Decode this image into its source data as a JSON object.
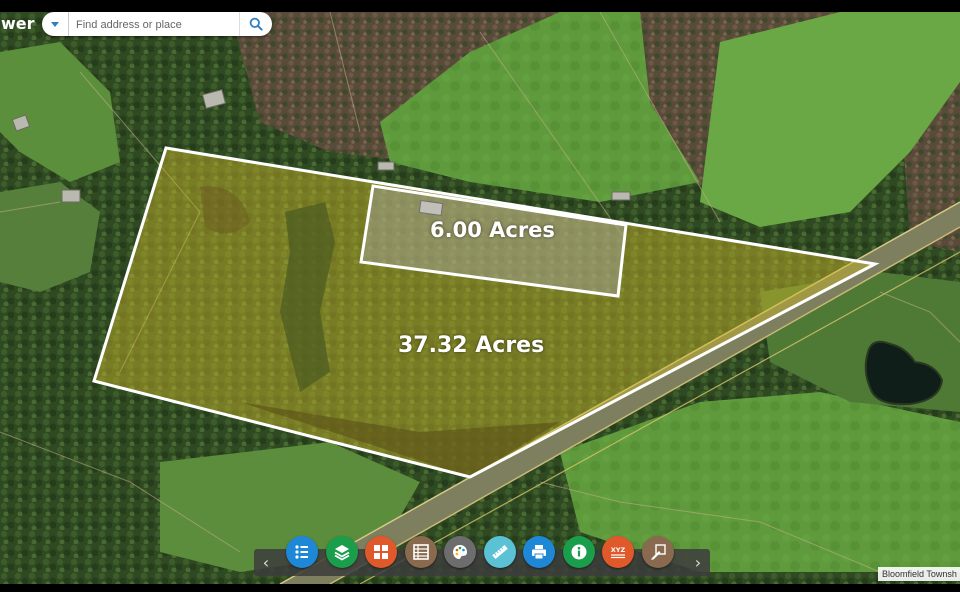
{
  "app": {
    "title_partial": "wer"
  },
  "search": {
    "placeholder": "Find address or place"
  },
  "parcels": [
    {
      "label": "6.00 Acres"
    },
    {
      "label": "37.32 Acres"
    }
  ],
  "toolbar": {
    "tools": [
      {
        "icon": "legend-list-icon",
        "color": "#1e88d6"
      },
      {
        "icon": "layers-icon",
        "color": "#1a9e4b"
      },
      {
        "icon": "basemap-grid-icon",
        "color": "#e0592a"
      },
      {
        "icon": "table-icon",
        "color": "#8a6a4f"
      },
      {
        "icon": "palette-icon",
        "color": "#6d6d6d"
      },
      {
        "icon": "measure-ruler-icon",
        "color": "#5bc2d6"
      },
      {
        "icon": "print-icon",
        "color": "#1e88d6"
      },
      {
        "icon": "info-icon",
        "color": "#1a9e4b"
      },
      {
        "icon": "xyz-coordinates-icon",
        "color": "#e0592a"
      },
      {
        "icon": "draw-markup-icon",
        "color": "#8a6a4f"
      }
    ]
  },
  "attribution": {
    "text": "Bloomfield Townsh"
  }
}
